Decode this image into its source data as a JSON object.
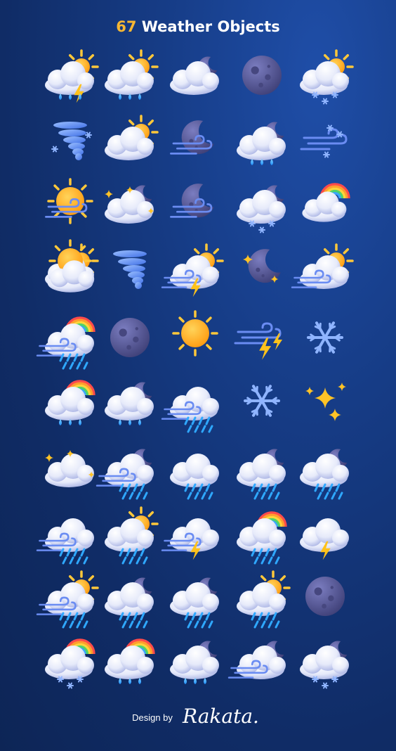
{
  "title": {
    "count": "67",
    "text": "Weather Objects"
  },
  "footer": {
    "design_by": "Design by",
    "brand": "Rakata."
  },
  "colors": {
    "cloud": "#eef1fb",
    "cloud_shade": "#b9c2ea",
    "sun": "#ffb21e",
    "sun_ray": "#ffc83a",
    "moon": "#5d5f9e",
    "moon_crater": "#46477f",
    "rain": "#2fa8ff",
    "lightning": "#ffc21a",
    "wind": "#6a8cf2",
    "snow": "#8fb4ff",
    "star": "#ffc326"
  },
  "icons": [
    [
      "cloud-sun-rain-lightning",
      "cloud-sun-rain",
      "cloud-moon",
      "moon",
      "cloud-sun-snow"
    ],
    [
      "tornado-snow",
      "cloud-sun",
      "moon-wind",
      "cloud-moon-rain",
      "wind-snow"
    ],
    [
      "sun-wind",
      "cloud-moon-star",
      "moon-wind",
      "cloud-moon-snow",
      "rainbow-cloud"
    ],
    [
      "sun-cloud",
      "tornado",
      "cloud-sun-wind-lightning",
      "moon-star",
      "cloud-sun-wind"
    ],
    [
      "cloud-rainbow-wind-rain",
      "moon",
      "sun",
      "wind-lightning",
      "snowflake"
    ],
    [
      "cloud-rainbow-rain",
      "cloud-moon-rain",
      "cloud-wind-rain",
      "snowflake",
      "stars"
    ],
    [
      "cloud-star",
      "cloud-moon-wind-rain",
      "cloud-rain",
      "cloud-moon-rain",
      "cloud-moon-rain"
    ],
    [
      "cloud-wind-rain",
      "cloud-sun-rain",
      "cloud-wind-lightning",
      "cloud-rainbow-rain",
      "cloud-lightning"
    ],
    [
      "cloud-sun-wind-rain",
      "cloud-moon-rain",
      "cloud-moon-rain",
      "cloud-sun-rain",
      "moon"
    ],
    [
      "cloud-rainbow-snow",
      "cloud-rainbow-rain",
      "cloud-moon-rain",
      "cloud-moon-wind",
      "cloud-moon-snow"
    ]
  ]
}
